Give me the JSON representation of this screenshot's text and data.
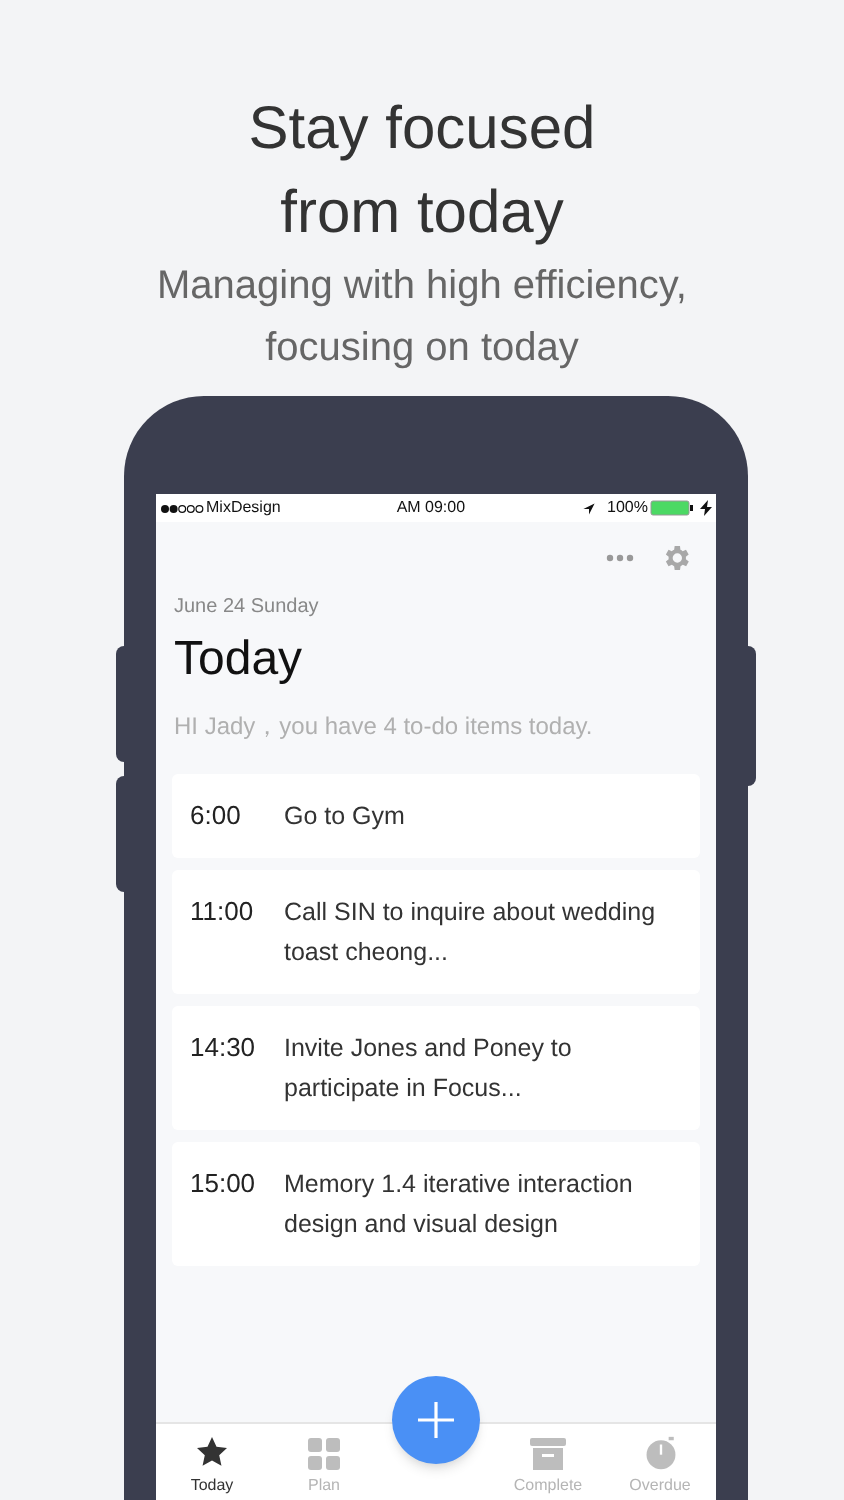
{
  "headline": "Stay focused from today",
  "subheadline": "Managing with high efficiency, focusing on today",
  "status_bar": {
    "carrier": "MixDesign",
    "time": "AM 09:00",
    "battery": "100%"
  },
  "date": "June 24 Sunday",
  "title": "Today",
  "greeting": "HI Jady，you have 4 to-do items today.",
  "todos": [
    {
      "time": "6:00",
      "text": "Go to Gym"
    },
    {
      "time": "11:00",
      "text": "Call SIN to inquire about wedding toast cheong..."
    },
    {
      "time": "14:30",
      "text": "Invite Jones and Poney to participate in Focus..."
    },
    {
      "time": "15:00",
      "text": "Memory 1.4 iterative interaction design and visual design"
    }
  ],
  "tabs": [
    {
      "label": "Today",
      "selected": true
    },
    {
      "label": "Plan",
      "selected": false
    },
    {
      "label": "Complete",
      "selected": false
    },
    {
      "label": "Overdue",
      "selected": false
    }
  ]
}
